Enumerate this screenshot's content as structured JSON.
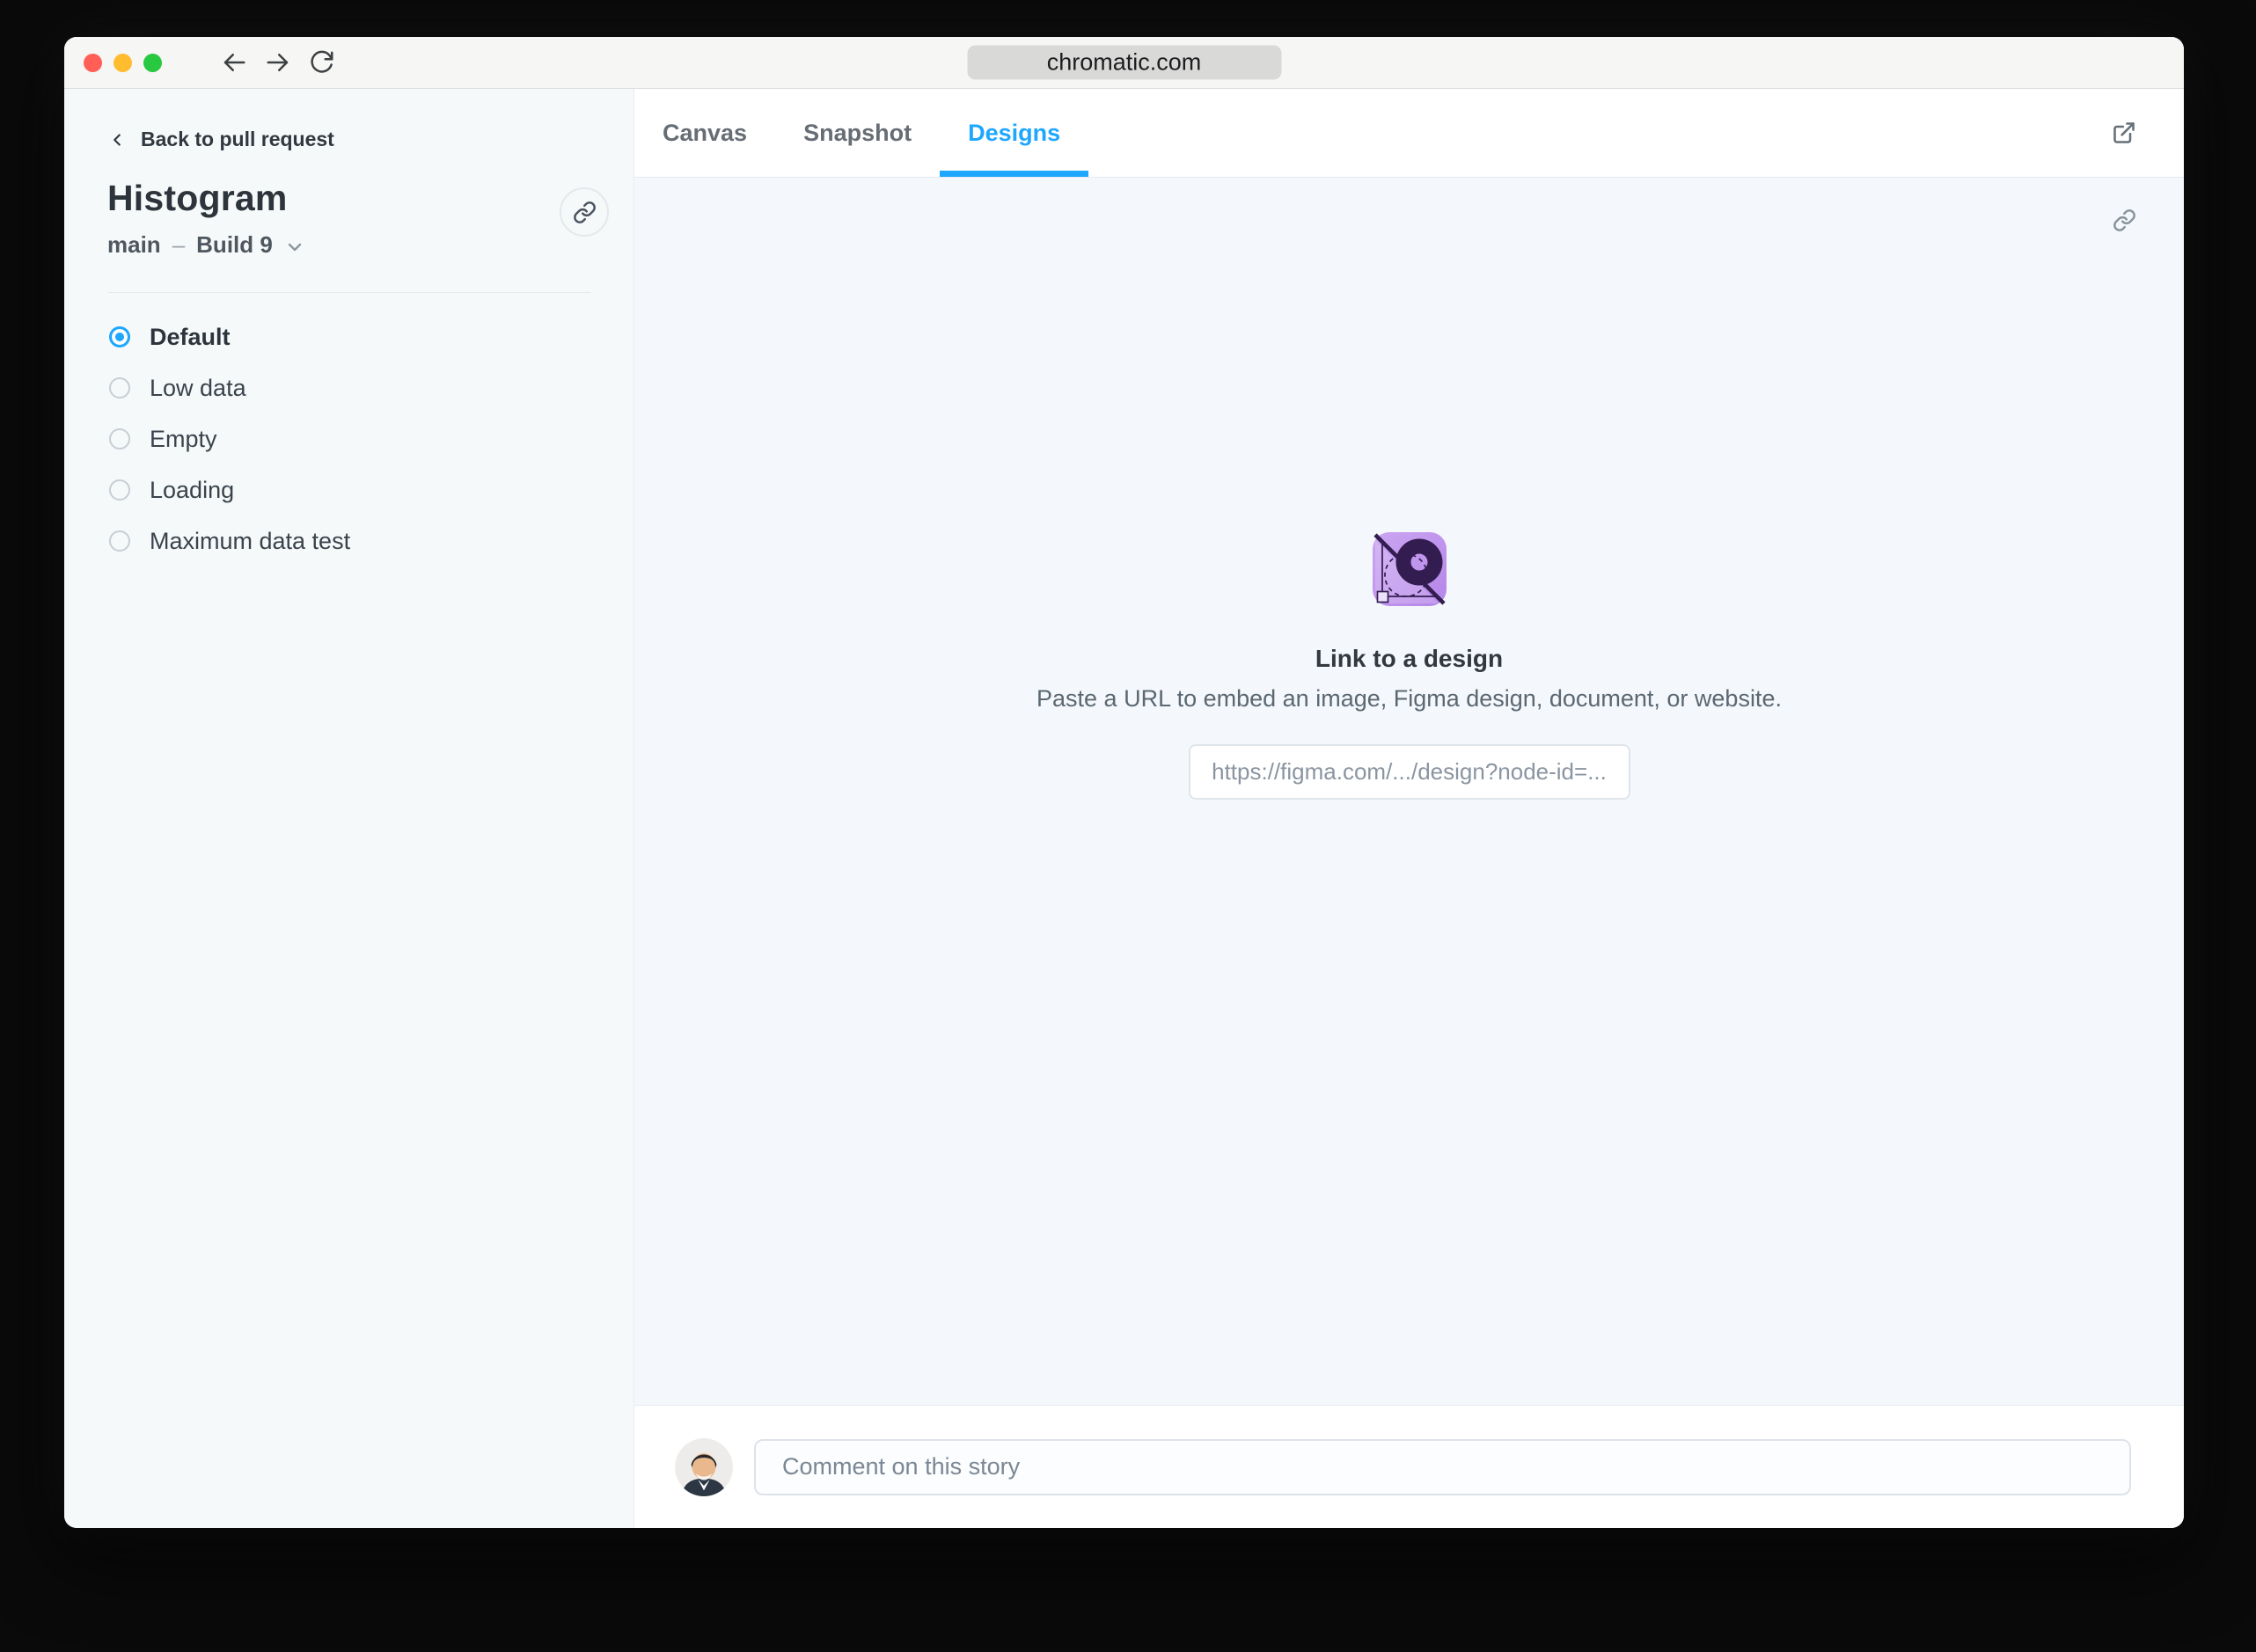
{
  "browser": {
    "url": "chromatic.com"
  },
  "sidebar": {
    "back_label": "Back to pull request",
    "title": "Histogram",
    "branch": "main",
    "dash": "–",
    "build_label": "Build 9",
    "stories": [
      {
        "label": "Default"
      },
      {
        "label": "Low data"
      },
      {
        "label": "Empty"
      },
      {
        "label": "Loading"
      },
      {
        "label": "Maximum data test"
      }
    ]
  },
  "main": {
    "tabs": [
      {
        "label": "Canvas"
      },
      {
        "label": "Snapshot"
      },
      {
        "label": "Designs"
      }
    ],
    "designs": {
      "heading": "Link to a design",
      "description": "Paste a URL to embed an image, Figma design, document, or website.",
      "url_placeholder": "https://figma.com/.../design?node-id=..."
    },
    "comment_placeholder": "Comment on this story"
  },
  "colors": {
    "accent_blue": "#1EA7FD",
    "traffic_red": "#FF5F57",
    "traffic_yellow": "#FEBC2E",
    "traffic_green": "#28C840",
    "design_icon_purple": "#BD90EE",
    "design_icon_dark": "#331D50"
  }
}
